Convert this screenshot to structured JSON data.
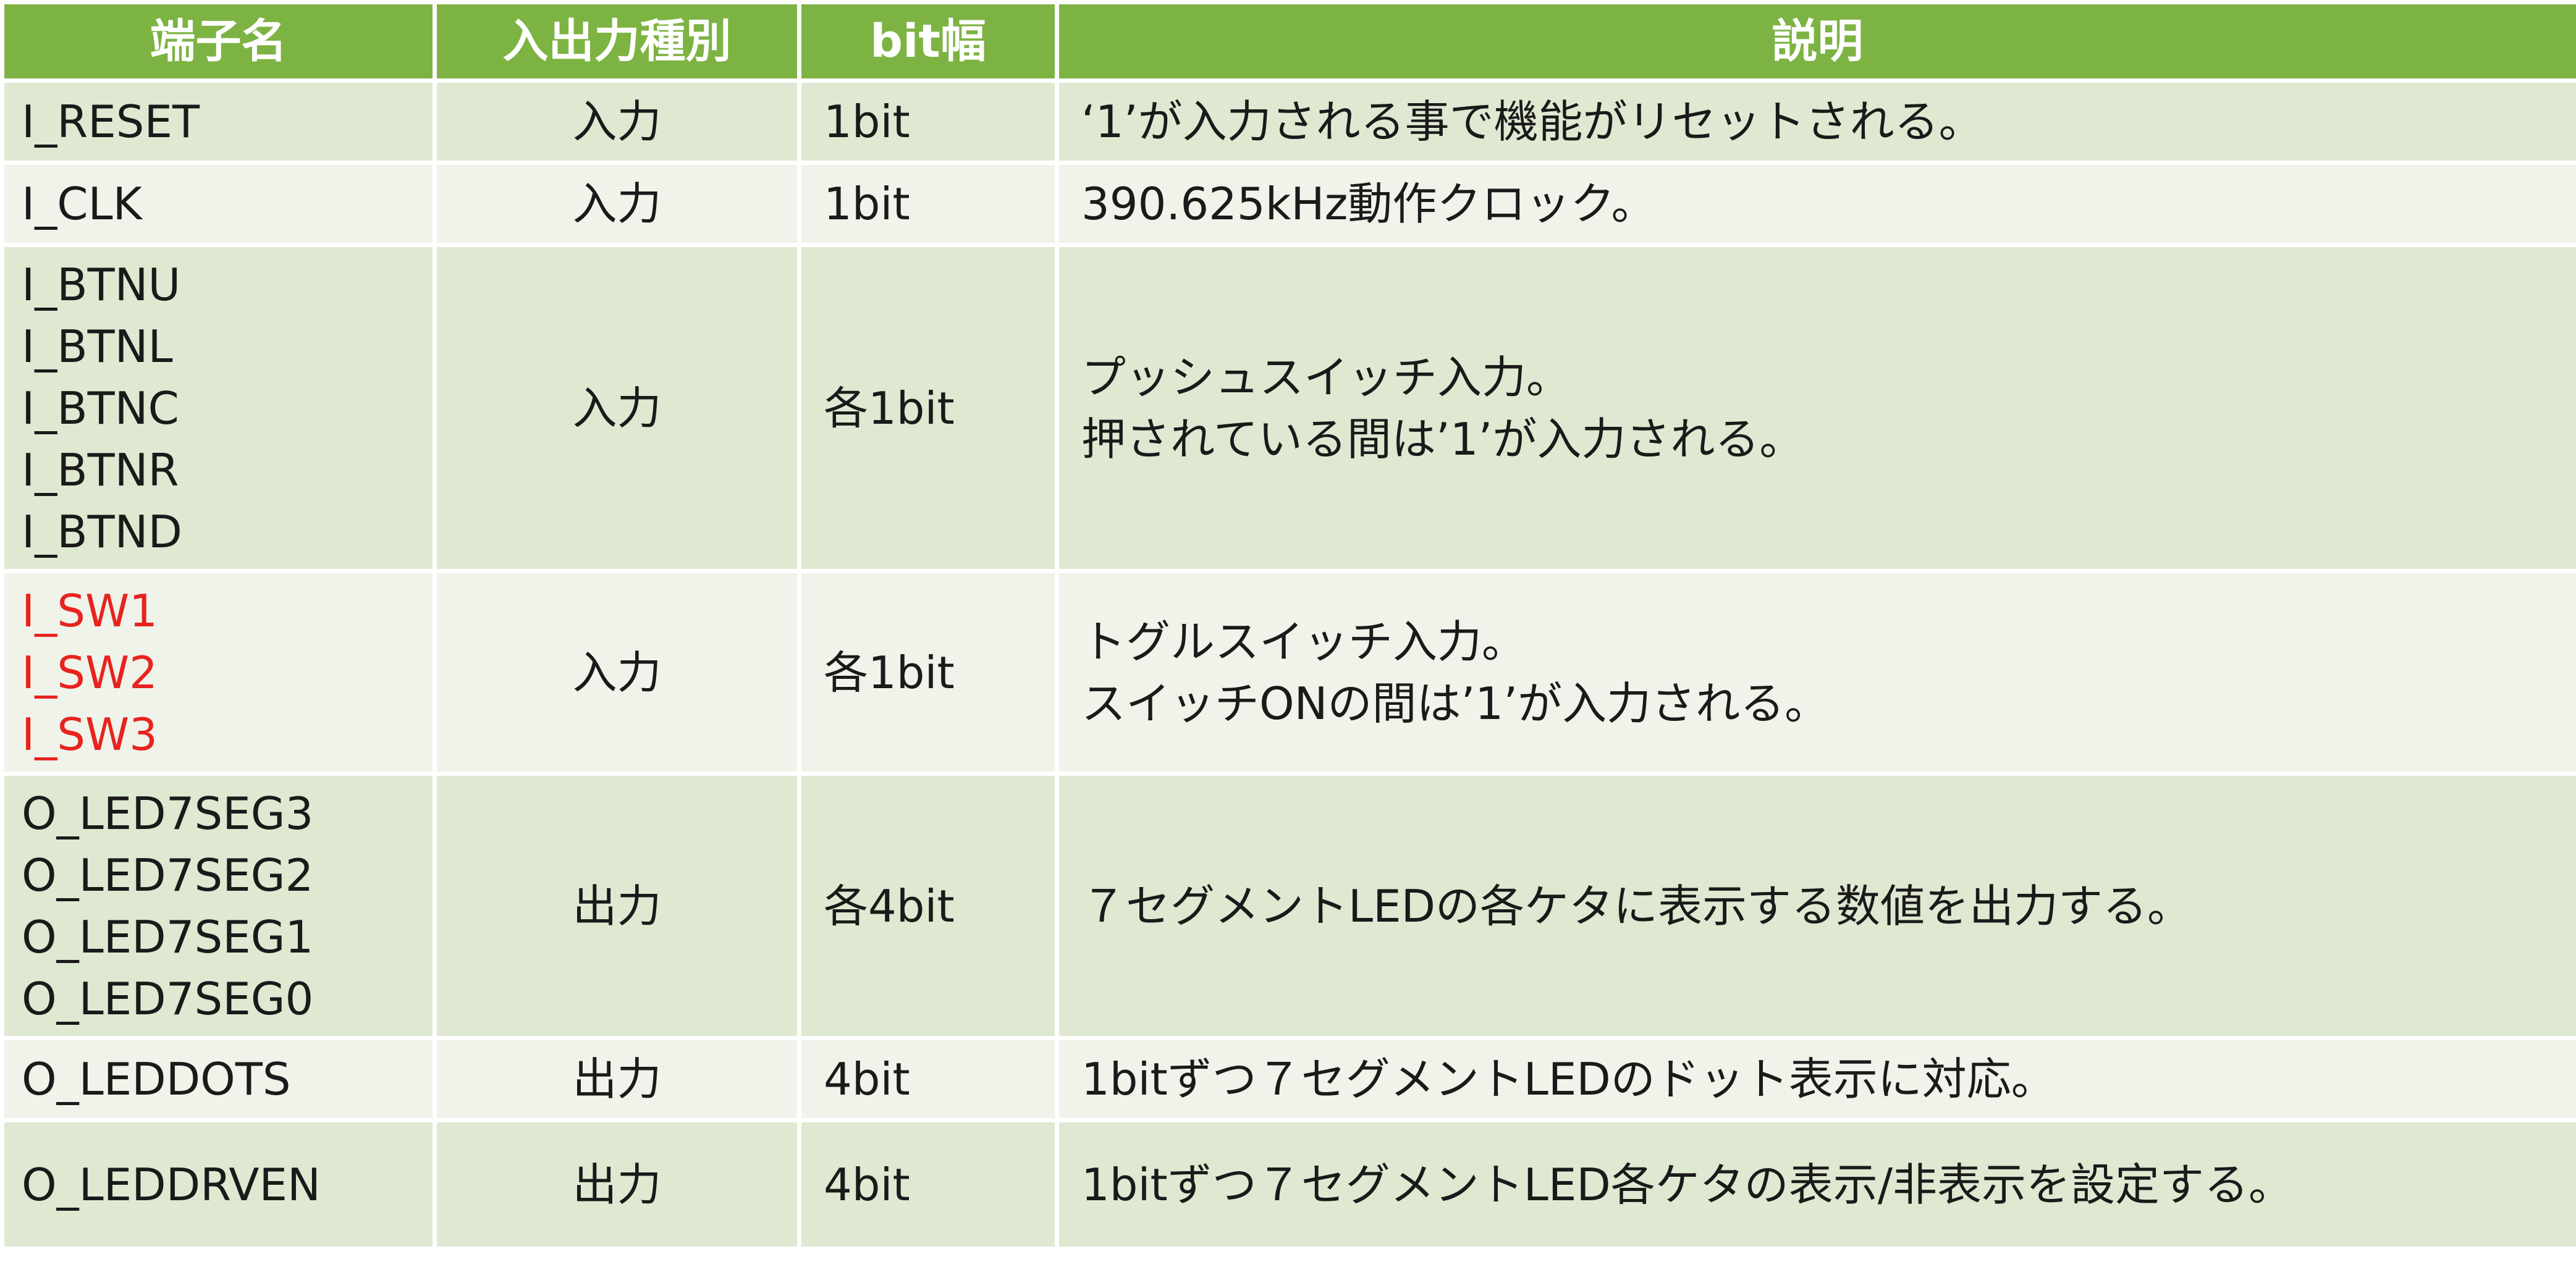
{
  "headers": {
    "name": "端子名",
    "io_type": "入出力種別",
    "bit_width": "bit幅",
    "description": "説明"
  },
  "rows": [
    {
      "names": [
        "I_RESET"
      ],
      "io_type": "入力",
      "bit_width": "1bit",
      "description": [
        "‘1’が入力される事で機能がリセットされる。"
      ]
    },
    {
      "names": [
        "I_CLK"
      ],
      "io_type": "入力",
      "bit_width": "1bit",
      "description": [
        "390.625kHz動作クロック。"
      ]
    },
    {
      "names": [
        "I_BTNU",
        "I_BTNL",
        "I_BTNC",
        "I_BTNR",
        "I_BTND"
      ],
      "io_type": "入力",
      "bit_width": "各1bit",
      "description": [
        "プッシュスイッチ入力。",
        "押されている間は’1’が入力される。"
      ]
    },
    {
      "names": [
        "I_SW1",
        "I_SW2",
        "I_SW3"
      ],
      "names_color": "#e8231e",
      "io_type": "入力",
      "bit_width": "各1bit",
      "description": [
        "トグルスイッチ入力。",
        "スイッチONの間は’1’が入力される。"
      ]
    },
    {
      "names": [
        "O_LED7SEG3",
        "O_LED7SEG2",
        "O_LED7SEG1",
        "O_LED7SEG0"
      ],
      "io_type": "出力",
      "bit_width": "各4bit",
      "description": [
        "７セグメントLEDの各ケタに表示する数値を出力する。"
      ]
    },
    {
      "names": [
        "O_LEDDOTS"
      ],
      "io_type": "出力",
      "bit_width": "4bit",
      "description": [
        "1bitずつ７セグメントLEDのドット表示に対応。"
      ]
    },
    {
      "names": [
        "O_LEDDRVEN"
      ],
      "io_type": "出力",
      "bit_width": "4bit",
      "description": [
        "1bitずつ７セグメントLED各ケタの表示/非表示を設定する。"
      ]
    }
  ],
  "colors": {
    "header_bg": "#7db342",
    "row_dark": "#dfe8d1",
    "row_light": "#eff3ea",
    "highlight_text": "#e8231e"
  }
}
